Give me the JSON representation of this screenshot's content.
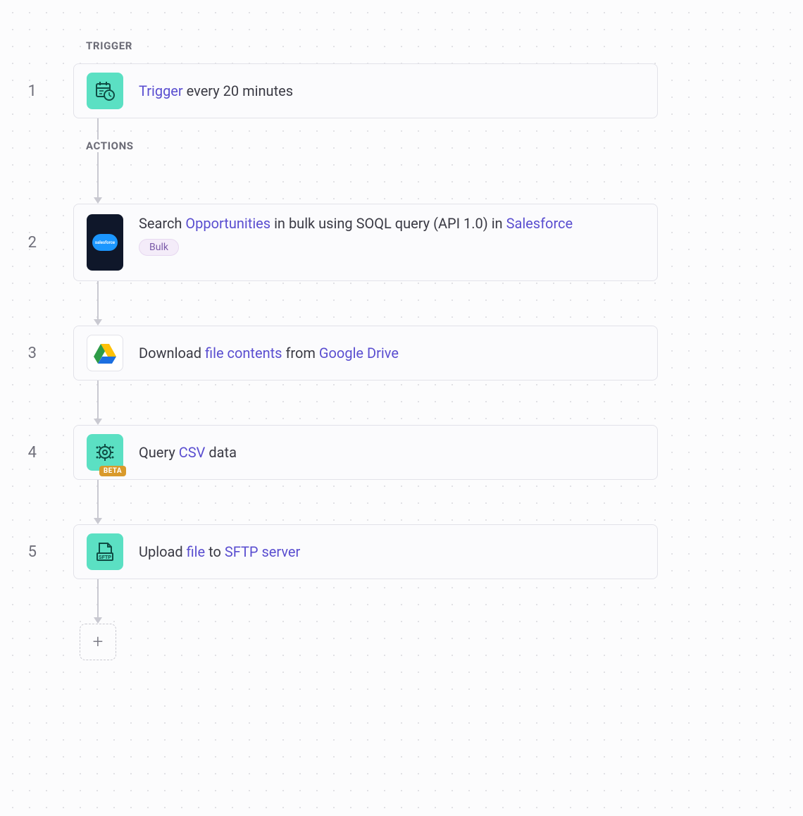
{
  "sections": {
    "trigger_label": "TRIGGER",
    "actions_label": "ACTIONS"
  },
  "steps": [
    {
      "num": "1",
      "icon": "schedule",
      "title_parts": [
        "",
        "Trigger",
        " every 20 minutes"
      ]
    },
    {
      "num": "2",
      "icon": "salesforce",
      "title_parts": [
        "Search ",
        "Opportunities",
        " in bulk using SOQL query (API 1.0) in ",
        "Salesforce"
      ],
      "pill": "Bulk"
    },
    {
      "num": "3",
      "icon": "gdrive",
      "title_parts": [
        "Download ",
        "file contents",
        " from ",
        "Google Drive"
      ]
    },
    {
      "num": "4",
      "icon": "csv",
      "badge": "BETA",
      "title_parts": [
        "Query ",
        "CSV",
        " data"
      ]
    },
    {
      "num": "5",
      "icon": "sftp",
      "title_parts": [
        "Upload ",
        "file",
        " to ",
        "SFTP server"
      ]
    }
  ],
  "add_button": "+"
}
